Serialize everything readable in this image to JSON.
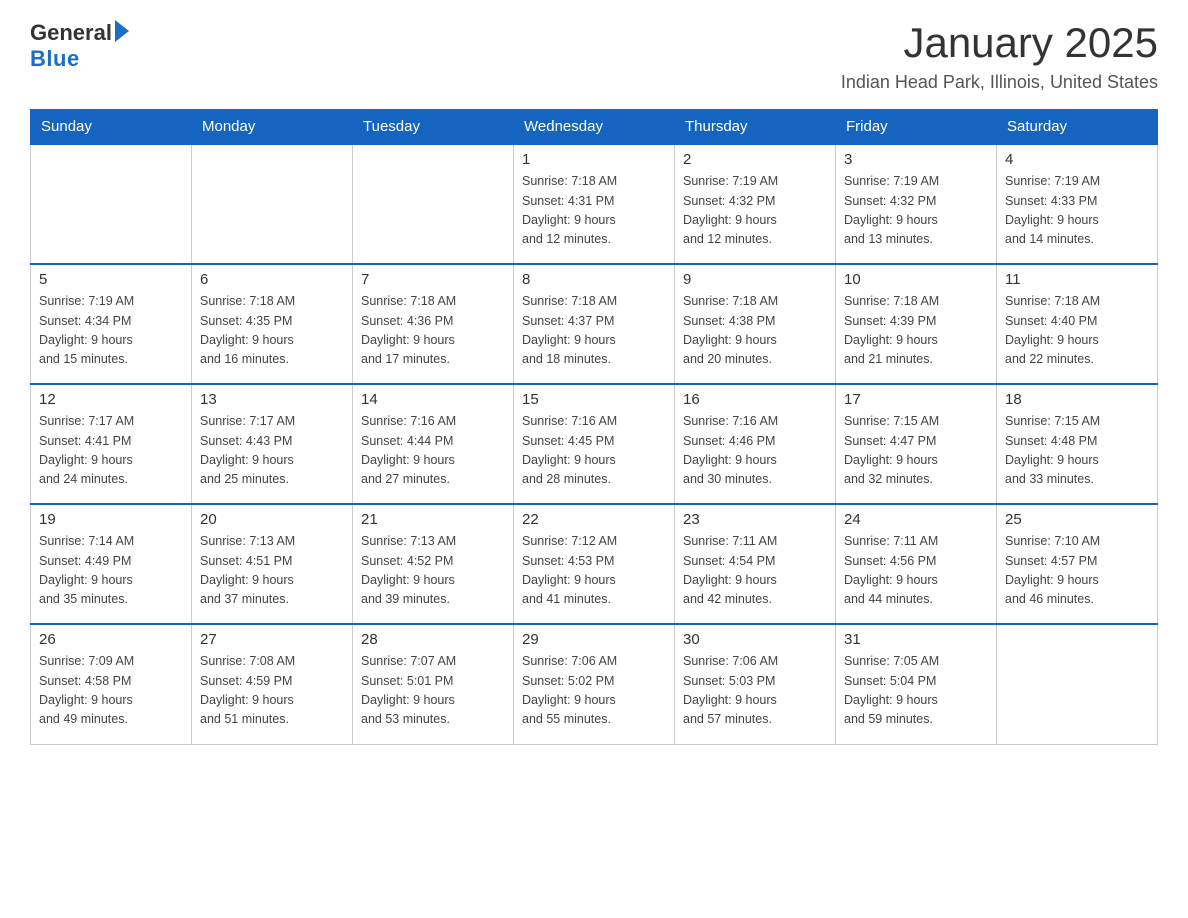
{
  "header": {
    "logo_general": "General",
    "logo_blue": "Blue",
    "month_title": "January 2025",
    "location": "Indian Head Park, Illinois, United States"
  },
  "days_of_week": [
    "Sunday",
    "Monday",
    "Tuesday",
    "Wednesday",
    "Thursday",
    "Friday",
    "Saturday"
  ],
  "weeks": [
    [
      {
        "day": "",
        "info": ""
      },
      {
        "day": "",
        "info": ""
      },
      {
        "day": "",
        "info": ""
      },
      {
        "day": "1",
        "info": "Sunrise: 7:18 AM\nSunset: 4:31 PM\nDaylight: 9 hours\nand 12 minutes."
      },
      {
        "day": "2",
        "info": "Sunrise: 7:19 AM\nSunset: 4:32 PM\nDaylight: 9 hours\nand 12 minutes."
      },
      {
        "day": "3",
        "info": "Sunrise: 7:19 AM\nSunset: 4:32 PM\nDaylight: 9 hours\nand 13 minutes."
      },
      {
        "day": "4",
        "info": "Sunrise: 7:19 AM\nSunset: 4:33 PM\nDaylight: 9 hours\nand 14 minutes."
      }
    ],
    [
      {
        "day": "5",
        "info": "Sunrise: 7:19 AM\nSunset: 4:34 PM\nDaylight: 9 hours\nand 15 minutes."
      },
      {
        "day": "6",
        "info": "Sunrise: 7:18 AM\nSunset: 4:35 PM\nDaylight: 9 hours\nand 16 minutes."
      },
      {
        "day": "7",
        "info": "Sunrise: 7:18 AM\nSunset: 4:36 PM\nDaylight: 9 hours\nand 17 minutes."
      },
      {
        "day": "8",
        "info": "Sunrise: 7:18 AM\nSunset: 4:37 PM\nDaylight: 9 hours\nand 18 minutes."
      },
      {
        "day": "9",
        "info": "Sunrise: 7:18 AM\nSunset: 4:38 PM\nDaylight: 9 hours\nand 20 minutes."
      },
      {
        "day": "10",
        "info": "Sunrise: 7:18 AM\nSunset: 4:39 PM\nDaylight: 9 hours\nand 21 minutes."
      },
      {
        "day": "11",
        "info": "Sunrise: 7:18 AM\nSunset: 4:40 PM\nDaylight: 9 hours\nand 22 minutes."
      }
    ],
    [
      {
        "day": "12",
        "info": "Sunrise: 7:17 AM\nSunset: 4:41 PM\nDaylight: 9 hours\nand 24 minutes."
      },
      {
        "day": "13",
        "info": "Sunrise: 7:17 AM\nSunset: 4:43 PM\nDaylight: 9 hours\nand 25 minutes."
      },
      {
        "day": "14",
        "info": "Sunrise: 7:16 AM\nSunset: 4:44 PM\nDaylight: 9 hours\nand 27 minutes."
      },
      {
        "day": "15",
        "info": "Sunrise: 7:16 AM\nSunset: 4:45 PM\nDaylight: 9 hours\nand 28 minutes."
      },
      {
        "day": "16",
        "info": "Sunrise: 7:16 AM\nSunset: 4:46 PM\nDaylight: 9 hours\nand 30 minutes."
      },
      {
        "day": "17",
        "info": "Sunrise: 7:15 AM\nSunset: 4:47 PM\nDaylight: 9 hours\nand 32 minutes."
      },
      {
        "day": "18",
        "info": "Sunrise: 7:15 AM\nSunset: 4:48 PM\nDaylight: 9 hours\nand 33 minutes."
      }
    ],
    [
      {
        "day": "19",
        "info": "Sunrise: 7:14 AM\nSunset: 4:49 PM\nDaylight: 9 hours\nand 35 minutes."
      },
      {
        "day": "20",
        "info": "Sunrise: 7:13 AM\nSunset: 4:51 PM\nDaylight: 9 hours\nand 37 minutes."
      },
      {
        "day": "21",
        "info": "Sunrise: 7:13 AM\nSunset: 4:52 PM\nDaylight: 9 hours\nand 39 minutes."
      },
      {
        "day": "22",
        "info": "Sunrise: 7:12 AM\nSunset: 4:53 PM\nDaylight: 9 hours\nand 41 minutes."
      },
      {
        "day": "23",
        "info": "Sunrise: 7:11 AM\nSunset: 4:54 PM\nDaylight: 9 hours\nand 42 minutes."
      },
      {
        "day": "24",
        "info": "Sunrise: 7:11 AM\nSunset: 4:56 PM\nDaylight: 9 hours\nand 44 minutes."
      },
      {
        "day": "25",
        "info": "Sunrise: 7:10 AM\nSunset: 4:57 PM\nDaylight: 9 hours\nand 46 minutes."
      }
    ],
    [
      {
        "day": "26",
        "info": "Sunrise: 7:09 AM\nSunset: 4:58 PM\nDaylight: 9 hours\nand 49 minutes."
      },
      {
        "day": "27",
        "info": "Sunrise: 7:08 AM\nSunset: 4:59 PM\nDaylight: 9 hours\nand 51 minutes."
      },
      {
        "day": "28",
        "info": "Sunrise: 7:07 AM\nSunset: 5:01 PM\nDaylight: 9 hours\nand 53 minutes."
      },
      {
        "day": "29",
        "info": "Sunrise: 7:06 AM\nSunset: 5:02 PM\nDaylight: 9 hours\nand 55 minutes."
      },
      {
        "day": "30",
        "info": "Sunrise: 7:06 AM\nSunset: 5:03 PM\nDaylight: 9 hours\nand 57 minutes."
      },
      {
        "day": "31",
        "info": "Sunrise: 7:05 AM\nSunset: 5:04 PM\nDaylight: 9 hours\nand 59 minutes."
      },
      {
        "day": "",
        "info": ""
      }
    ]
  ]
}
